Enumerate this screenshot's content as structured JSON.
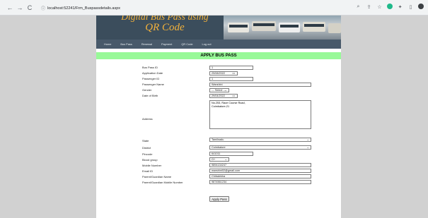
{
  "browser": {
    "back_icon": "arrow-left-icon",
    "forward_icon": "arrow-right-icon",
    "reload_icon": "reload-icon",
    "url": "localhost:52241/Frm_Buspassdetails.aspx"
  },
  "banner": {
    "title_line1": "Digital Bus Pass using",
    "title_line2": "QR Code"
  },
  "menu": {
    "items": [
      "Home",
      "Bus Pass",
      "Renewal",
      "Payment",
      "QR Code",
      "Log out"
    ]
  },
  "form": {
    "title": "APPLY BUS PASS",
    "fields": {
      "bus_pass_id": {
        "label": "Bus Pass ID",
        "value": "1"
      },
      "application_date": {
        "label": "Application Date",
        "value": "29/08/2022"
      },
      "passenger_id": {
        "label": "Passenger ID",
        "value": "1"
      },
      "passenger_name": {
        "label": "Passenger Name",
        "value": "Wanshini"
      },
      "gender": {
        "label": "Gender",
        "value": "--- Select --- "
      },
      "date_of_birth": {
        "label": "Date of Birth",
        "value": "29/04/2022"
      },
      "address": {
        "label": "Address",
        "value": "No.253, Race Course Road,\nCoimbatore-21"
      },
      "state": {
        "label": "State",
        "value": "Tamilnadu"
      },
      "district": {
        "label": "District",
        "value": "Coimbatore"
      },
      "pincode": {
        "label": "Pincode",
        "value": "641011"
      },
      "blood_group": {
        "label": "Blood group",
        "value": "O+"
      },
      "mobile_number": {
        "label": "Mobile Number",
        "value": "9894134247"
      },
      "email_id": {
        "label": "Email ID",
        "value": "wanshini02@gmail.com"
      },
      "guardian_name": {
        "label": "Parent/Guardian Name",
        "value": "Chitralekha"
      },
      "guardian_mobile": {
        "label": "Parent/Guardian Mobile Number",
        "value": "9874561234"
      }
    },
    "apply_button": "Apply Pass"
  }
}
